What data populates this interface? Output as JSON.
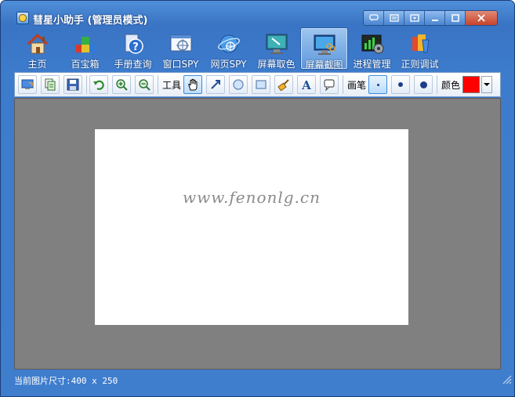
{
  "window": {
    "title": "彗星小助手 (管理员模式)"
  },
  "nav": {
    "items": [
      {
        "label": "主页",
        "icon": "home-icon"
      },
      {
        "label": "百宝箱",
        "icon": "toolbox-icon"
      },
      {
        "label": "手册查询",
        "icon": "help-book-icon"
      },
      {
        "label": "窗口SPY",
        "icon": "window-spy-icon"
      },
      {
        "label": "网页SPY",
        "icon": "web-spy-icon"
      },
      {
        "label": "屏幕取色",
        "icon": "color-picker-icon"
      },
      {
        "label": "屏幕截图",
        "icon": "screenshot-icon"
      },
      {
        "label": "进程管理",
        "icon": "process-icon"
      },
      {
        "label": "正则调试",
        "icon": "regex-icon"
      }
    ],
    "active_index": 6
  },
  "toolbar": {
    "tools_label": "工具",
    "pen_label": "画笔",
    "color_label": "颜色",
    "current_color": "#ff0000"
  },
  "canvas": {
    "watermark": "www.fenonlg.cn"
  },
  "status": {
    "text": "当前图片尺寸:400 x 250"
  },
  "colors": {
    "frame_blue": "#3d7bcc",
    "canvas_gray": "#808080",
    "accent_highlight": "#3d8be0"
  }
}
